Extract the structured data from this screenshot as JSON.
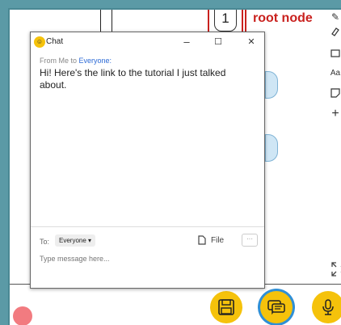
{
  "diagram": {
    "node_number": "1",
    "node_label": "root node"
  },
  "toolbar": {
    "text_tool_label": "Aa",
    "add_label": "+"
  },
  "chat": {
    "title": "Chat",
    "minimize_label": "–",
    "maximize_label": "☐",
    "close_label": "✕",
    "from_prefix": "From Me to",
    "recipient": "Everyone:",
    "message": "Hi! Here's the link to the tutorial I just talked about.",
    "to_label": "To:",
    "to_value": "Everyone",
    "file_label": "File",
    "more_label": "···",
    "compose_placeholder": "Type message here..."
  },
  "colors": {
    "frame": "#5b9aa6",
    "accent_red": "#c9211e",
    "fab_yellow": "#f5c20b",
    "selected_ring": "#2f8fd6"
  }
}
